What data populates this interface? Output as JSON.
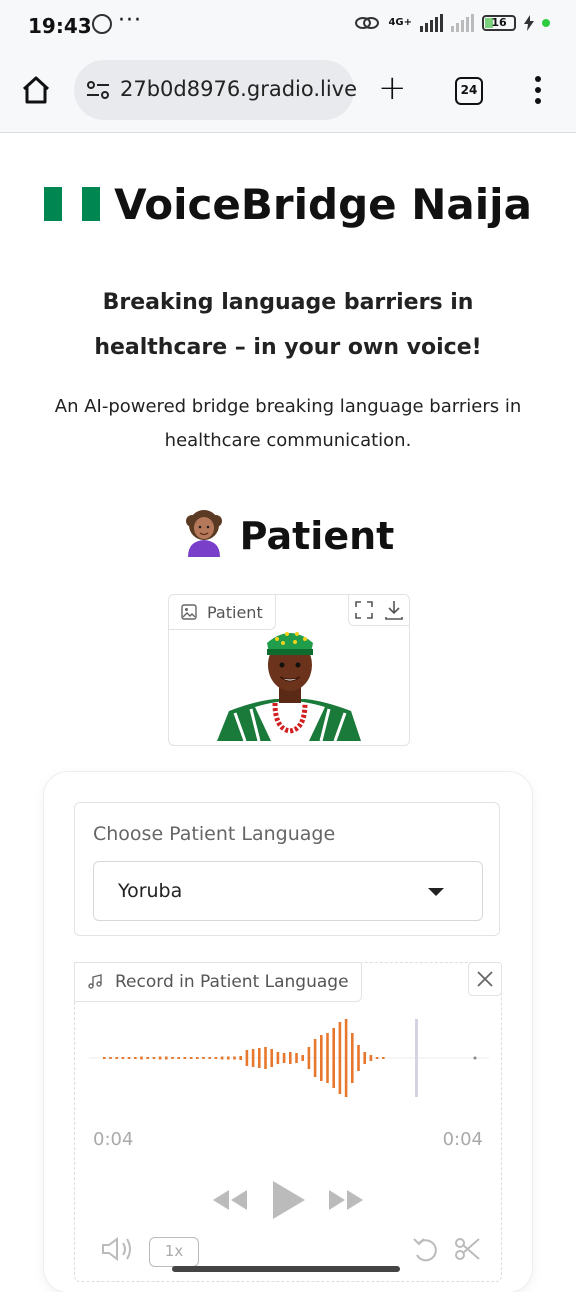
{
  "status_bar": {
    "time": "19:43",
    "more": "···",
    "network": "4G+",
    "battery": "16"
  },
  "browser": {
    "url": "27b0d8976.gradio.live",
    "tab_count": "24"
  },
  "page": {
    "title": "VoiceBridge Naija",
    "subtitle": "Breaking language barriers in healthcare – in your own voice!",
    "description": "An AI-powered bridge breaking language barriers in healthcare communication.",
    "patient_heading": "Patient",
    "image_label": "Patient"
  },
  "language_selector": {
    "label": "Choose Patient Language",
    "selected": "Yoruba"
  },
  "audio": {
    "label": "Record in Patient Language",
    "current_time": "0:04",
    "duration": "0:04",
    "speed": "1x"
  },
  "colors": {
    "wave": "#e8772e",
    "flag_green": "#008751"
  }
}
